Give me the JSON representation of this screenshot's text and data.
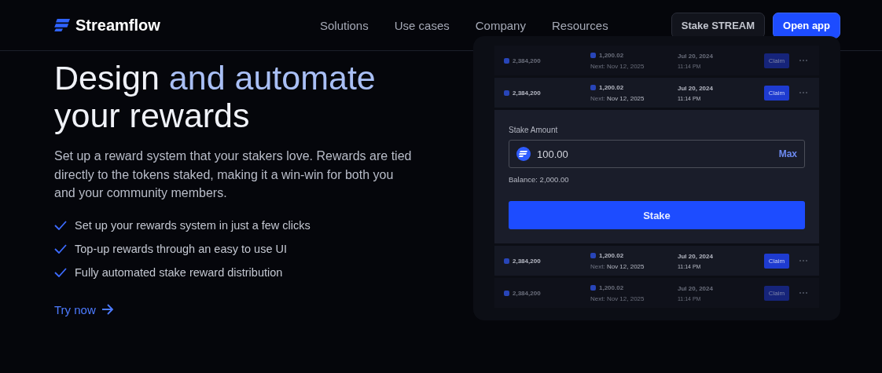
{
  "nav": {
    "brand": "Streamflow",
    "links": [
      "Solutions",
      "Use cases",
      "Company",
      "Resources"
    ],
    "buttons": [
      {
        "label": "Stake STREAM",
        "kind": "secondary"
      },
      {
        "label": "Open app",
        "kind": "primary"
      }
    ]
  },
  "hero": {
    "title_parts": [
      {
        "text": "Design ",
        "accent": false
      },
      {
        "text": "and automate",
        "accent": true
      },
      {
        "text": " your rewards",
        "accent": false
      }
    ],
    "description": "Set up a reward system that your stakers love. Rewards are tied directly to the tokens staked, making it a win-win for both you and your community members.",
    "features": [
      "Set up your rewards system in just a few clicks",
      "Top-up rewards through an easy to use UI",
      "Fully automated stake reward distribution"
    ],
    "cta": "Try now"
  },
  "preview": {
    "rows_top": [
      {
        "staked": "2,384,200",
        "reward": "1,200.02",
        "next_label": "Next:",
        "next": "Nov 12, 2025",
        "date": "Jul 20, 2024",
        "time": "11:14 PM",
        "action": "Claim",
        "highlighted": false
      },
      {
        "staked": "2,384,200",
        "reward": "1,200.02",
        "next_label": "Next:",
        "next": "Nov 12, 2025",
        "date": "Jul 20, 2024",
        "time": "11:14 PM",
        "action": "Claim",
        "highlighted": true
      }
    ],
    "stake_form": {
      "label": "Stake Amount",
      "value": "100.00",
      "max": "Max",
      "balance": "Balance: 2,000.00",
      "button": "Stake"
    },
    "rows_bottom": [
      {
        "staked": "2,384,200",
        "reward": "1,200.02",
        "next_label": "Next:",
        "next": "Nov 12, 2025",
        "date": "Jul 20, 2024",
        "time": "11:14 PM",
        "action": "Claim",
        "highlighted": true
      },
      {
        "staked": "2,384,200",
        "reward": "1,200.02",
        "next_label": "Next:",
        "next": "Nov 12, 2025",
        "date": "Jul 20, 2024",
        "time": "11:14 PM",
        "action": "Claim",
        "highlighted": false
      }
    ]
  }
}
